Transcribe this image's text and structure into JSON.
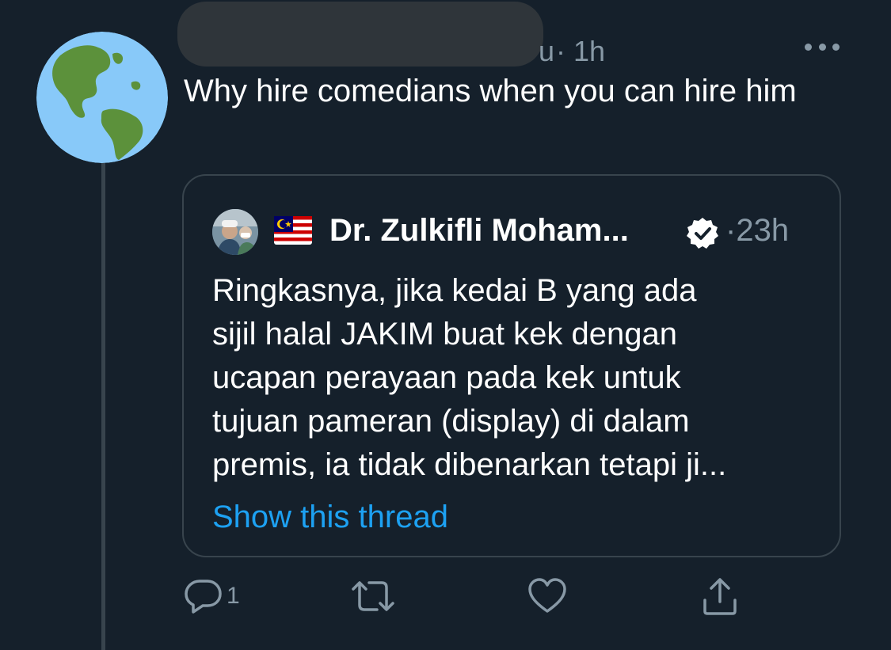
{
  "tweet": {
    "display_name_peek": "u",
    "separator": "·",
    "timestamp": "1h",
    "text": "Why hire comedians when you can hire him",
    "avatar_icon": "globe-americas-icon"
  },
  "quoted_tweet": {
    "flag_icon": "malaysia-flag-icon",
    "author_name": "Dr. Zulkifli Moham...",
    "verified_icon": "verified-badge-icon",
    "separator": "·",
    "timestamp": "23h",
    "body_lines": [
      "Ringkasnya, jika kedai B yang ada",
      "sijil halal JAKIM buat kek dengan",
      "ucapan perayaan pada kek untuk",
      "tujuan pameran (display) di dalam",
      "premis, ia tidak dibenarkan tetapi ji..."
    ],
    "show_thread_label": "Show this thread"
  },
  "actions": {
    "reply_count": "1",
    "reply_icon": "reply-icon",
    "retweet_icon": "retweet-icon",
    "like_icon": "heart-icon",
    "share_icon": "share-icon"
  },
  "colors": {
    "background": "#15202b",
    "border": "#38444d",
    "secondary_text": "#8899a6",
    "link": "#1da1f2"
  }
}
